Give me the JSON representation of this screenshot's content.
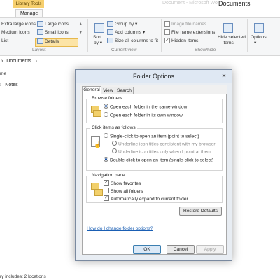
{
  "explorer": {
    "context_tab": "Library Tools",
    "title_ghost": "Document - Microsoft Wo",
    "window_title": "Documents",
    "tab_manage": "Manage",
    "layout": {
      "items": [
        "Extra large icons",
        "Large icons",
        "Medium icons",
        "Small icons",
        "List",
        "Details"
      ],
      "group_label": "Layout"
    },
    "current_view": {
      "sort_label": "Sort",
      "sort_sub": "by",
      "group_by": "Group by",
      "add_columns": "Add columns",
      "size_all": "Size all columns to fit",
      "group_label": "Current view"
    },
    "show_hide": {
      "item_checkboxes": "Image file names",
      "file_name_extensions": "File name extensions",
      "hidden_items": "Hidden items",
      "hide_selected": "Hide selected",
      "hide_selected_sub": "items",
      "group_label": "Show/hide"
    },
    "options_label": "Options",
    "address": "Documents",
    "column_header": "Notes",
    "nav_stub": "me",
    "status_text": "ry includes: 2 locations"
  },
  "dialog": {
    "title": "Folder Options",
    "close_glyph": "✕",
    "tabs": [
      "General",
      "View",
      "Search"
    ],
    "browse_folders": {
      "legend": "Browse folders",
      "options": [
        "Open each folder in the same window",
        "Open each folder in its own window"
      ],
      "selected": 0
    },
    "click_items": {
      "legend": "Click items as follows",
      "single_click": "Single-click to open an item (point to select)",
      "underline_consistent": "Underline icon titles consistent with my browser",
      "underline_point": "Underline icon titles only when I point at them",
      "double_click": "Double-click to open an item (single-click to select)",
      "selected": "double"
    },
    "navigation_pane": {
      "legend": "Navigation pane",
      "show_favorites": "Show favorites",
      "show_all_folders": "Show all folders",
      "auto_expand": "Automatically expand to current folder",
      "checked": {
        "show_favorites": true,
        "show_all_folders": false,
        "auto_expand": true
      }
    },
    "restore_defaults": "Restore Defaults",
    "help_link": "How do I change folder options?",
    "ok": "OK",
    "cancel": "Cancel",
    "apply": "Apply"
  }
}
